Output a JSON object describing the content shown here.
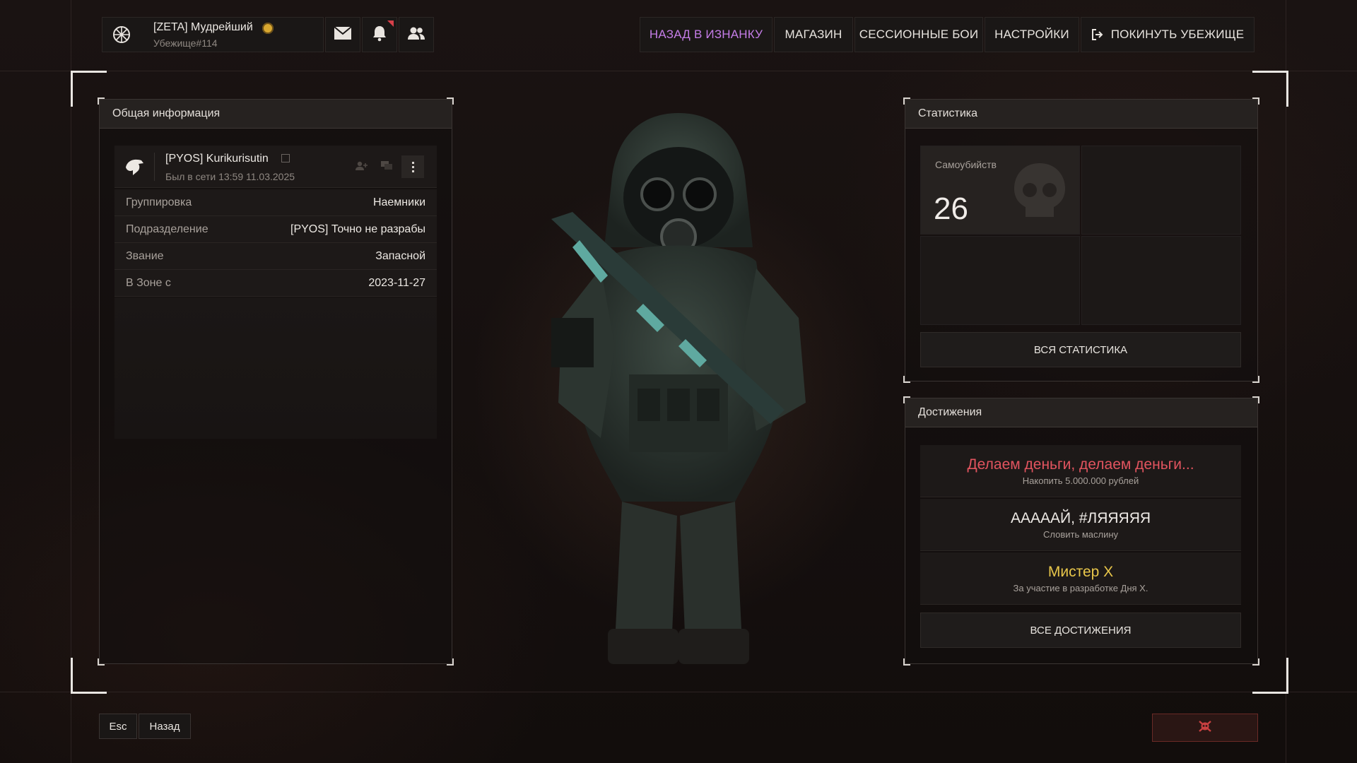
{
  "header": {
    "username": "[ZETA] Мудрейший",
    "shelter": "Убежище#114",
    "nav": [
      {
        "label": "НАЗАД В ИЗНАНКУ",
        "active": true
      },
      {
        "label": "МАГАЗИН"
      },
      {
        "label": "СЕССИОННЫЕ БОИ"
      },
      {
        "label": "НАСТРОЙКИ"
      },
      {
        "label": "ПОКИНУТЬ УБЕЖИЩЕ"
      }
    ]
  },
  "info_panel": {
    "title": "Общая информация",
    "player_name": "[PYOS] Kurikurisutin",
    "last_seen": "Был в сети 13:59 11.03.2025",
    "rows": [
      {
        "key": "Группировка",
        "value": "Наемники"
      },
      {
        "key": "Подразделение",
        "value": "[PYOS] Точно не разрабы"
      },
      {
        "key": "Звание",
        "value": "Запасной"
      },
      {
        "key": "В Зоне с",
        "value": "2023-11-27"
      }
    ]
  },
  "stats_panel": {
    "title": "Статистика",
    "stat_label": "Самоубийств",
    "stat_value": "26",
    "all_button": "ВСЯ СТАТИСТИКА"
  },
  "achievements_panel": {
    "title": "Достижения",
    "items": [
      {
        "title": "Делаем деньги, делаем деньги...",
        "desc": "Накопить 5.000.000 рублей",
        "color": "#e2545f"
      },
      {
        "title": "АААААЙ, #ЛЯЯЯЯЯ",
        "desc": "Словить маслину",
        "color": "#eeeae6"
      },
      {
        "title": "Мистер Х",
        "desc": "За участие в разработке Дня X.",
        "color": "#e8c64a"
      }
    ],
    "all_button": "ВСЕ ДОСТИЖЕНИЯ"
  },
  "footer": {
    "esc_label": "Esc",
    "back_label": "Назад"
  },
  "colors": {
    "accent": "#c57de8",
    "danger": "#c84040"
  }
}
